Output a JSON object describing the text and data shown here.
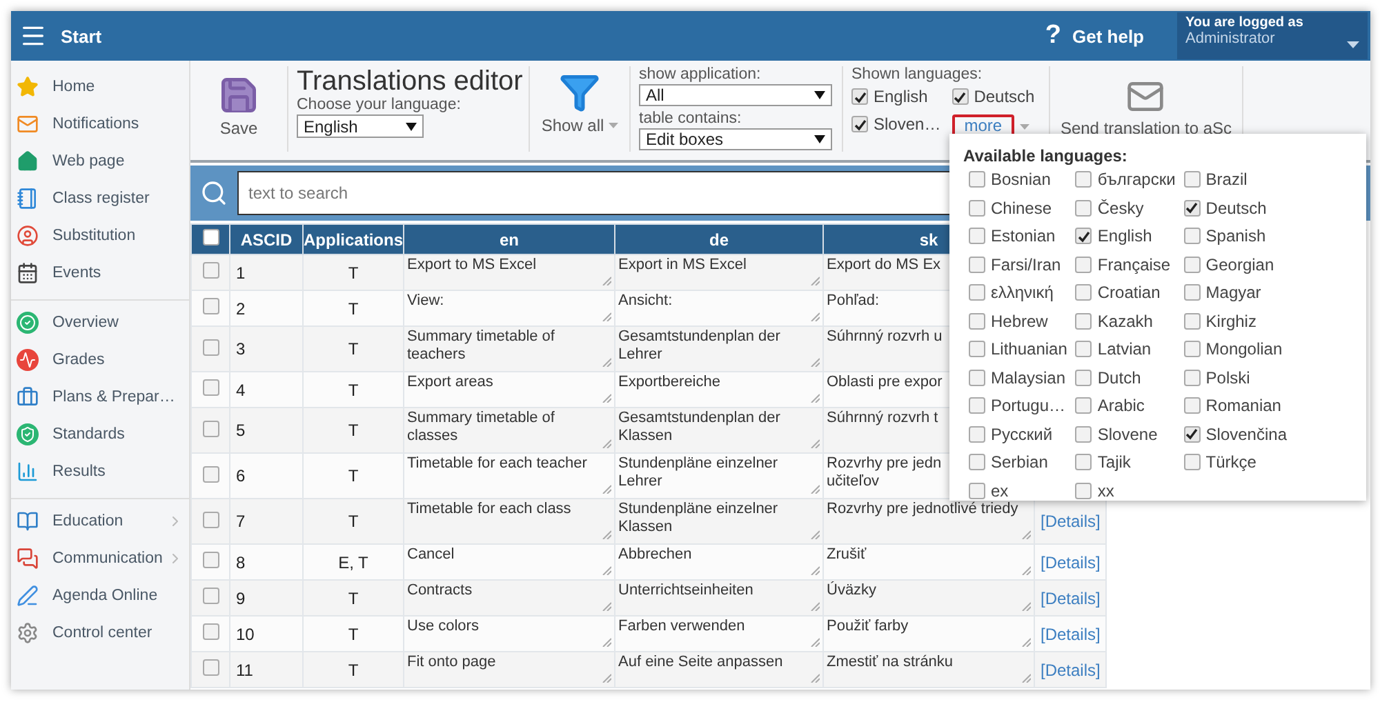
{
  "topbar": {
    "menu_label": "Start",
    "help": {
      "icon": "?",
      "label": "Get help"
    },
    "user": {
      "caption": "You are logged as",
      "name": "Administrator"
    }
  },
  "sidebar": {
    "sections": [
      {
        "items": [
          {
            "label": "Home",
            "submenu": false
          },
          {
            "label": "Notifications",
            "submenu": false
          },
          {
            "label": "Web page",
            "submenu": false
          },
          {
            "label": "Class register",
            "submenu": false
          },
          {
            "label": "Substitution",
            "submenu": false
          },
          {
            "label": "Events",
            "submenu": false
          }
        ]
      },
      {
        "items": [
          {
            "label": "Overview",
            "submenu": false
          },
          {
            "label": "Grades",
            "submenu": false
          },
          {
            "label": "Plans & Prepar…",
            "submenu": false
          },
          {
            "label": "Standards",
            "submenu": false
          },
          {
            "label": "Results",
            "submenu": false
          }
        ]
      },
      {
        "items": [
          {
            "label": "Education",
            "submenu": true
          },
          {
            "label": "Communication",
            "submenu": true
          },
          {
            "label": "Agenda Online",
            "submenu": false
          },
          {
            "label": "Control center",
            "submenu": false
          }
        ]
      }
    ]
  },
  "toolbar": {
    "save_button": {
      "label": "Save"
    },
    "title": "Translations editor",
    "language": {
      "label": "Choose your language:",
      "value": "English"
    },
    "filter_button": {
      "label": "Show all"
    },
    "application_filter": {
      "label": "show application:",
      "value": "All"
    },
    "table_filter": {
      "label": "table contains:",
      "value": "Edit boxes"
    },
    "shown_languages": {
      "label": "Shown languages:",
      "items": [
        {
          "label": "English",
          "checked": true
        },
        {
          "label": "Deutsch",
          "checked": true
        },
        {
          "label": "Sloven…",
          "checked": true
        }
      ],
      "more_link": "more"
    },
    "send_button": {
      "label": "Send translation to aSc"
    }
  },
  "search": {
    "placeholder": "text to search"
  },
  "table": {
    "header_checkbox": {
      "checked": false
    },
    "columns": [
      "ASCID",
      "Applications",
      "en",
      "de",
      "sk"
    ],
    "rows": [
      {
        "checked": false,
        "ascid": "1",
        "applications": "T",
        "en": "Export to MS Excel",
        "de": "Export in MS Excel",
        "sk": "Export do MS Ex"
      },
      {
        "checked": false,
        "ascid": "2",
        "applications": "T",
        "en": "View:",
        "de": "Ansicht:",
        "sk": "Pohľad:"
      },
      {
        "checked": false,
        "ascid": "3",
        "applications": "T",
        "en": "Summary timetable of\nteachers",
        "de": "Gesamtstundenplan der\nLehrer",
        "sk": "Súhrnný rozvrh u"
      },
      {
        "checked": false,
        "ascid": "4",
        "applications": "T",
        "en": "Export areas",
        "de": "Exportbereiche",
        "sk": "Oblasti pre expor"
      },
      {
        "checked": false,
        "ascid": "5",
        "applications": "T",
        "en": "Summary timetable of\nclasses",
        "de": "Gesamtstundenplan der\nKlassen",
        "sk": "Súhrnný rozvrh t"
      },
      {
        "checked": false,
        "ascid": "6",
        "applications": "T",
        "en": "Timetable for each teacher",
        "de": "Stundenpläne einzelner\nLehrer",
        "sk": "Rozvrhy pre jedn\nučiteľov"
      },
      {
        "checked": false,
        "ascid": "7",
        "applications": "T",
        "en": "Timetable for each class",
        "de": "Stundenpläne einzelner\nKlassen",
        "sk": "Rozvrhy pre jednotlivé triedy",
        "details": "[Details]"
      },
      {
        "checked": false,
        "ascid": "8",
        "applications": "E, T",
        "en": "Cancel",
        "de": "Abbrechen",
        "sk": "Zrušiť",
        "details": "[Details]"
      },
      {
        "checked": false,
        "ascid": "9",
        "applications": "T",
        "en": "Contracts",
        "de": "Unterrichtseinheiten",
        "sk": "Úväzky",
        "details": "[Details]"
      },
      {
        "checked": false,
        "ascid": "10",
        "applications": "T",
        "en": "Use colors",
        "de": "Farben verwenden",
        "sk": "Použiť farby",
        "details": "[Details]"
      },
      {
        "checked": false,
        "ascid": "11",
        "applications": "T",
        "en": "Fit onto page",
        "de": "Auf eine Seite anpassen",
        "sk": "Zmestiť na stránku",
        "details": "[Details]"
      }
    ]
  },
  "languages_popup": {
    "title": "Available languages:",
    "languages": [
      {
        "label": "Bosnian",
        "checked": false
      },
      {
        "label": "български",
        "checked": false
      },
      {
        "label": "Brazil",
        "checked": false
      },
      {
        "label": "Chinese",
        "checked": false
      },
      {
        "label": "Česky",
        "checked": false
      },
      {
        "label": "Deutsch",
        "checked": true
      },
      {
        "label": "Estonian",
        "checked": false
      },
      {
        "label": "English",
        "checked": true
      },
      {
        "label": "Spanish",
        "checked": false
      },
      {
        "label": "Farsi/Iran",
        "checked": false
      },
      {
        "label": "Française",
        "checked": false
      },
      {
        "label": "Georgian",
        "checked": false
      },
      {
        "label": "ελληνική",
        "checked": false
      },
      {
        "label": "Croatian",
        "checked": false
      },
      {
        "label": "Magyar",
        "checked": false
      },
      {
        "label": "Hebrew",
        "checked": false
      },
      {
        "label": "Kazakh",
        "checked": false
      },
      {
        "label": "Kirghiz",
        "checked": false
      },
      {
        "label": "Lithuanian",
        "checked": false
      },
      {
        "label": "Latvian",
        "checked": false
      },
      {
        "label": "Mongolian",
        "checked": false
      },
      {
        "label": "Malaysian",
        "checked": false
      },
      {
        "label": "Dutch",
        "checked": false
      },
      {
        "label": "Polski",
        "checked": false
      },
      {
        "label": "Portugu…",
        "checked": false
      },
      {
        "label": "Arabic",
        "checked": false
      },
      {
        "label": "Romanian",
        "checked": false
      },
      {
        "label": "Русский",
        "checked": false
      },
      {
        "label": "Slovene",
        "checked": false
      },
      {
        "label": "Slovenčina",
        "checked": true
      },
      {
        "label": "Serbian",
        "checked": false
      },
      {
        "label": "Tajik",
        "checked": false
      },
      {
        "label": "Türkçe",
        "checked": false
      },
      {
        "label": "ex",
        "checked": false
      },
      {
        "label": "xx",
        "checked": false
      }
    ]
  }
}
